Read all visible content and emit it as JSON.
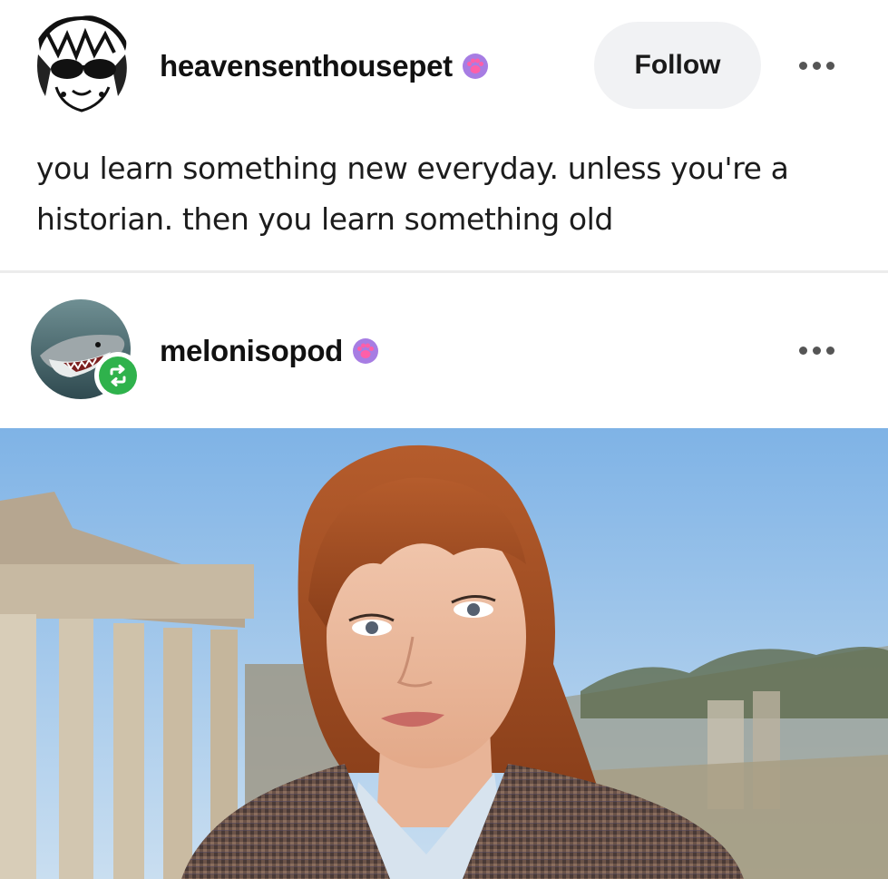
{
  "post": {
    "author": {
      "username": "heavensenthousepet",
      "avatar_icon": "sketch-face-avatar",
      "badge_icon": "paw-icon"
    },
    "follow_label": "Follow",
    "more_icon": "more-dots-icon",
    "text": "you learn something new everyday. unless you're a historian. then you learn something old"
  },
  "reblog": {
    "author": {
      "username": "melonisopod",
      "avatar_icon": "shark-avatar",
      "badge_icon": "paw-icon",
      "reblog_icon": "reblog-arrows-icon"
    },
    "more_icon": "more-dots-icon",
    "image_description_icon": "photo-woman-roman-forum"
  },
  "colors": {
    "follow_bg": "#f1f2f4",
    "reblog_green": "#2fb24c",
    "paw_purple": "#a77de3",
    "paw_pink": "#ff5fa8",
    "sky": "#8fbde8"
  }
}
